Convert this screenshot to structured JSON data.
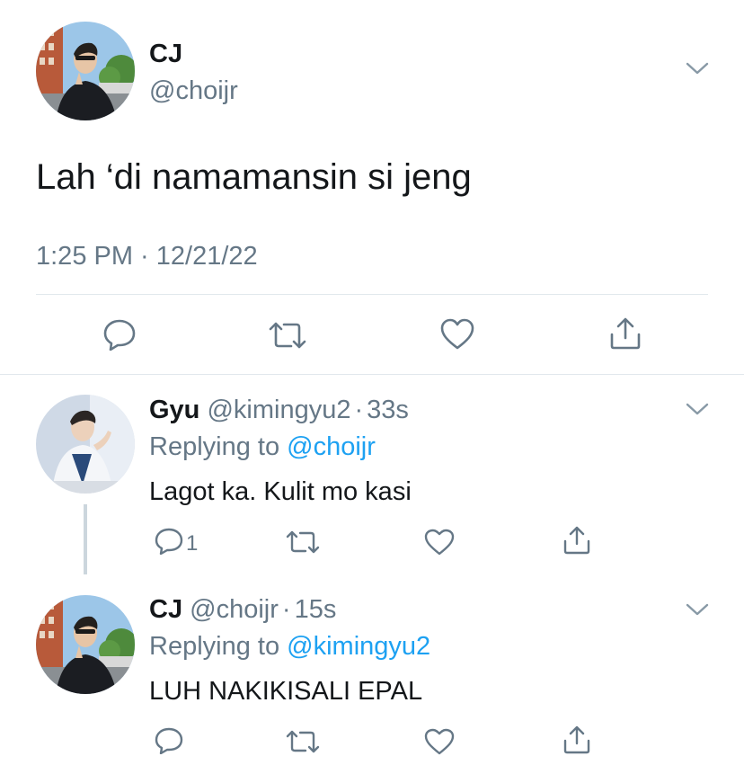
{
  "main_tweet": {
    "name": "CJ",
    "handle": "@choijr",
    "text": "Lah ‘di namamansin si jeng",
    "timestamp": "1:25 PM · 12/21/22"
  },
  "replies": [
    {
      "name": "Gyu",
      "handle": "@kimingyu2",
      "separator": "·",
      "time": "33s",
      "replying_label": "Replying to",
      "replying_to": "@choijr",
      "text": "Lagot ka. Kulit mo kasi",
      "reply_count": "1"
    },
    {
      "name": "CJ",
      "handle": "@choijr",
      "separator": "·",
      "time": "15s",
      "replying_label": "Replying to",
      "replying_to": "@kimingyu2",
      "text": "LUH NAKIKISALI EPAL",
      "reply_count": ""
    }
  ],
  "icons": {
    "reply": "reply-icon",
    "retweet": "retweet-icon",
    "like": "like-icon",
    "share": "share-icon",
    "more": "chevron-down-icon"
  },
  "colors": {
    "accent": "#1da1f2",
    "muted": "#657786",
    "text": "#14171a",
    "divider": "#e1e8ed"
  }
}
